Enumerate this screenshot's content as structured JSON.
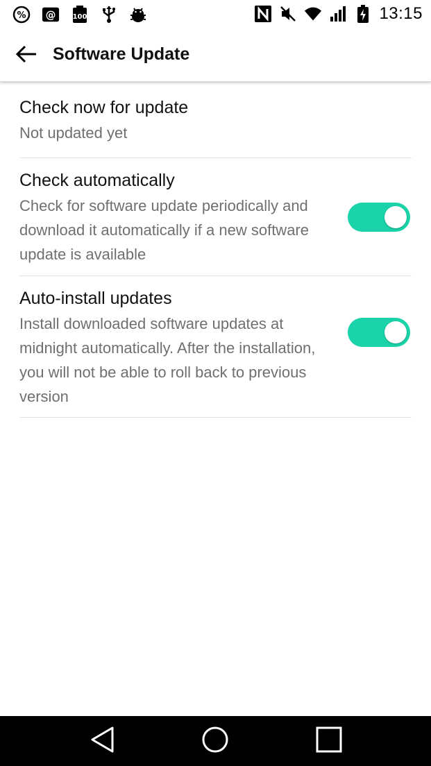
{
  "status_bar": {
    "time": "13:15",
    "left_icons": [
      "data-saver-icon",
      "email-icon",
      "battery-100-icon",
      "usb-icon",
      "android-debug-icon"
    ],
    "right_icons": [
      "nfc-icon",
      "mute-icon",
      "wifi-icon",
      "signal-icon",
      "battery-charging-icon"
    ]
  },
  "app_bar": {
    "title": "Software Update",
    "back_icon": "arrow-left-icon"
  },
  "settings": [
    {
      "title": "Check now for update",
      "subtitle": "Not updated yet"
    },
    {
      "title": "Check automatically",
      "subtitle": "Check for software update periodically and download it automatically if a new software update is available",
      "toggle": true
    },
    {
      "title": "Auto-install updates",
      "subtitle": "Install downloaded software updates at midnight automatically. After the installation, you will not be able to roll back to previous version",
      "toggle": true
    }
  ],
  "colors": {
    "toggle_on": "#1ad3a9",
    "subtitle_text": "#6f6f6f",
    "nav_bar": "#000000"
  },
  "nav_bar": {
    "icons": [
      "back-triangle-icon",
      "home-circle-icon",
      "recents-square-icon"
    ]
  }
}
